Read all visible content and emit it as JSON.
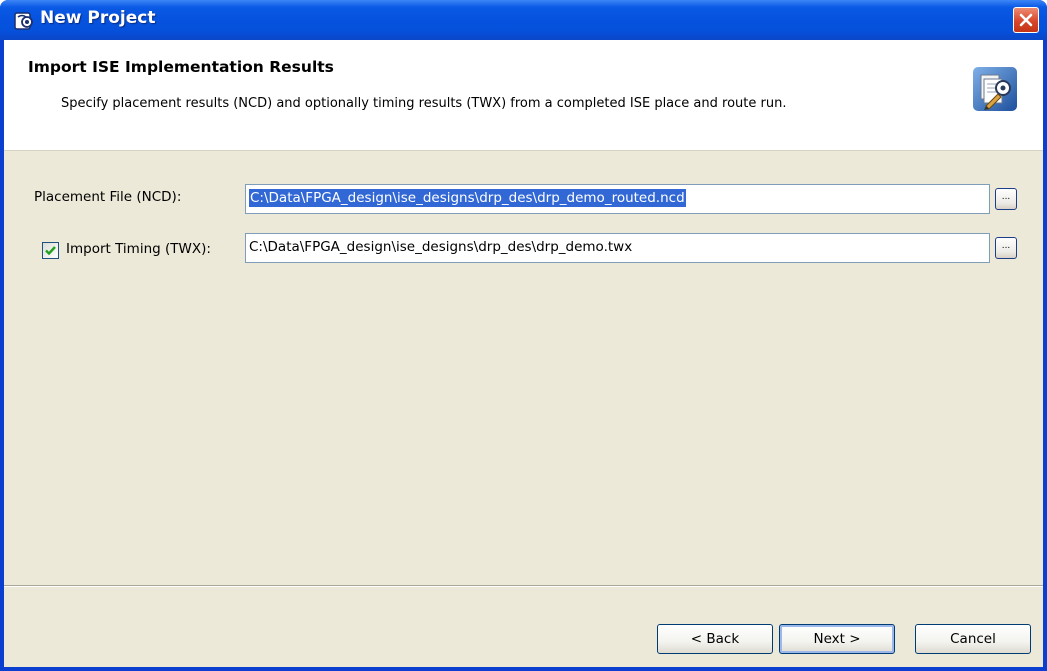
{
  "window": {
    "title": "New Project",
    "app_icon": "app-logo-icon",
    "close_icon": "close-icon"
  },
  "header": {
    "title": "Import ISE Implementation Results",
    "description": "Specify placement results (NCD) and optionally timing results (TWX) from a completed ISE place and route run.",
    "icon": "wizard-icon"
  },
  "form": {
    "placement_label": "Placement File (NCD):",
    "placement_value": "C:\\Data\\FPGA_design\\ise_designs\\drp_des\\drp_demo_routed.ncd",
    "placement_browse_label": "...",
    "timing_checked": true,
    "timing_label": "Import Timing (TWX):",
    "timing_value": "C:\\Data\\FPGA_design\\ise_designs\\drp_des\\drp_demo.twx",
    "timing_browse_label": "..."
  },
  "buttons": {
    "back": "< Back",
    "next": "Next >",
    "cancel": "Cancel"
  }
}
